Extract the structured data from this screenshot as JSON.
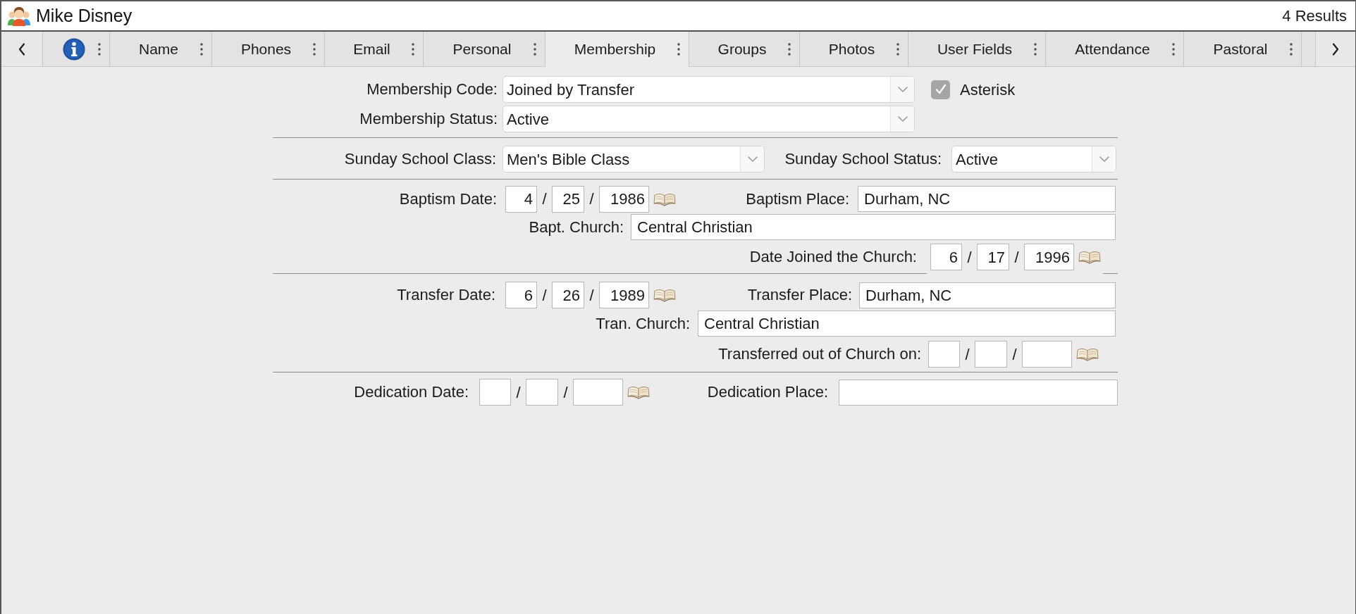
{
  "window": {
    "title": "Mike Disney",
    "result_count": "4 Results"
  },
  "tabs": [
    {
      "kind": "info",
      "selected": false
    },
    {
      "kind": "text",
      "label": "Name",
      "selected": false
    },
    {
      "kind": "text",
      "label": "Phones",
      "selected": false
    },
    {
      "kind": "text",
      "label": "Email",
      "selected": false
    },
    {
      "kind": "text",
      "label": "Personal",
      "selected": false
    },
    {
      "kind": "text",
      "label": "Membership",
      "selected": true
    },
    {
      "kind": "text",
      "label": "Groups",
      "selected": false
    },
    {
      "kind": "text",
      "label": "Photos",
      "selected": false
    },
    {
      "kind": "text",
      "label": "User Fields",
      "selected": false
    },
    {
      "kind": "text",
      "label": "Attendance",
      "selected": false
    },
    {
      "kind": "text",
      "label": "Pastoral",
      "selected": false
    }
  ],
  "membership": {
    "code": {
      "label": "Membership Code:",
      "value": "Joined by Transfer"
    },
    "asterisk": {
      "label": "Asterisk",
      "checked": true
    },
    "status": {
      "label": "Membership Status:",
      "value": "Active"
    }
  },
  "sunday_school": {
    "class": {
      "label": "Sunday School Class:",
      "value": "Men's Bible Class"
    },
    "status": {
      "label": "Sunday School Status:",
      "value": "Active"
    }
  },
  "baptism": {
    "date": {
      "label": "Baptism Date:",
      "month": "4",
      "day": "25",
      "year": "1986",
      "separators": [
        "/",
        "/"
      ]
    },
    "place": {
      "label": "Baptism Place:",
      "value": "Durham, NC"
    },
    "church": {
      "label": "Bapt. Church:",
      "value": "Central Christian"
    },
    "joined": {
      "label": "Date Joined the Church:",
      "month": "6",
      "day": "17",
      "year": "1996",
      "separators": [
        "/",
        "/"
      ]
    }
  },
  "transfer": {
    "date": {
      "label": "Transfer Date:",
      "month": "6",
      "day": "26",
      "year": "1989",
      "separators": [
        "/",
        "/"
      ]
    },
    "place": {
      "label": "Transfer Place:",
      "value": "Durham, NC"
    },
    "church": {
      "label": "Tran. Church:",
      "value": "Central Christian"
    },
    "out_date": {
      "label": "Transferred out of Church on:",
      "separators": [
        "/",
        "/"
      ]
    }
  },
  "dedication": {
    "date": {
      "label": "Dedication Date:",
      "separators": [
        "/",
        "/"
      ]
    },
    "place": {
      "label": "Dedication Place:"
    }
  }
}
